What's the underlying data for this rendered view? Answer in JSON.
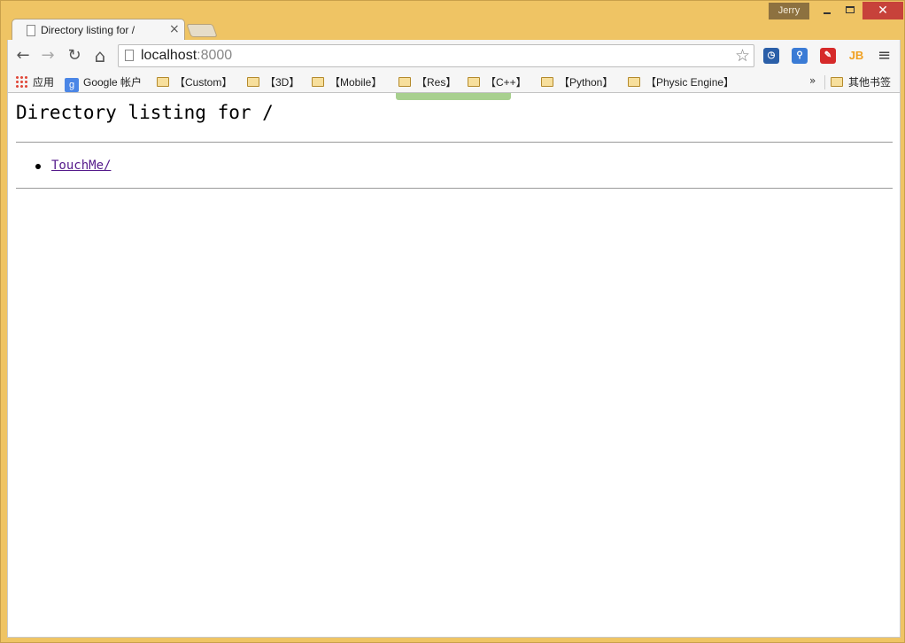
{
  "window": {
    "user_name": "Jerry",
    "minimize_label": "",
    "maximize_label": "",
    "close_label": "✕"
  },
  "tabs": [
    {
      "title": "Directory listing for /",
      "close": "×",
      "active": true
    }
  ],
  "toolbar": {
    "back_icon": "←",
    "forward_icon": "→",
    "reload_icon": "↻",
    "home_icon": "⌂",
    "url_host": "localhost",
    "url_port": ":8000",
    "star_icon": "☆",
    "menu_icon": "≡",
    "extensions": [
      {
        "name": "clock-extension-icon",
        "label": "◷",
        "color": "#2b5fa8"
      },
      {
        "name": "search-extension-icon",
        "label": "⚲",
        "color": "#3a7bd5"
      },
      {
        "name": "pdf-extension-icon",
        "label": "✎",
        "color": "#d62a2a"
      },
      {
        "name": "jb-extension-icon",
        "label": "JB",
        "color": "#f0a020"
      }
    ]
  },
  "bookmarks": {
    "apps": "应用",
    "google_account": "Google 帐户",
    "google_badge": "g",
    "folders": [
      "【Custom】",
      "【3D】",
      "【Mobile】",
      "【Res】",
      "【C++】",
      "【Python】",
      "【Physic Engine】"
    ],
    "overflow": "»",
    "other": "其他书签"
  },
  "page": {
    "heading": "Directory listing for /",
    "entries": [
      "TouchMe/"
    ]
  }
}
